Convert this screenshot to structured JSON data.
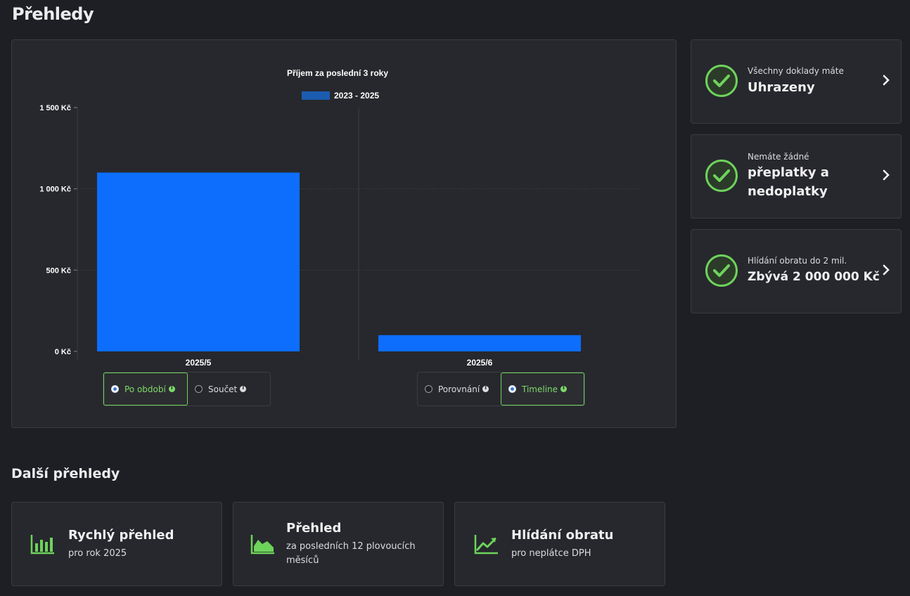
{
  "page": {
    "title": "Přehledy"
  },
  "chart_data": {
    "type": "bar",
    "title": "Příjem za poslední 3 roky",
    "categories": [
      "2025/5",
      "2025/6"
    ],
    "series": [
      {
        "name": "2023 - 2025",
        "values": [
          1100,
          100
        ],
        "color": "#0d6efd"
      }
    ],
    "yticks": [
      "0 Kč",
      "500 Kč",
      "1 000 Kč",
      "1 500 Kč"
    ],
    "ylim": [
      0,
      1500
    ],
    "legend_swatch_color": "#1c5cb0",
    "grid": true,
    "legend_position": "top-center"
  },
  "view_toggle": {
    "options": [
      {
        "label": "Po období",
        "active": true
      },
      {
        "label": "Součet",
        "active": false
      }
    ]
  },
  "mode_toggle": {
    "options": [
      {
        "label": "Porovnání",
        "active": false
      },
      {
        "label": "Timeline",
        "active": true
      }
    ]
  },
  "status_cards": [
    {
      "sub": "Všechny doklady máte",
      "main": "Uhrazeny"
    },
    {
      "sub": "Nemáte žádné",
      "main": "přeplatky a nedoplatky"
    },
    {
      "sub": "Hlídání obratu do 2 mil.",
      "main": "Zbývá 2 000 000 Kč"
    }
  ],
  "more": {
    "title": "Další přehledy",
    "tiles": [
      {
        "title": "Rychlý přehled",
        "sub": "pro rok 2025",
        "icon": "bar-chart-icon"
      },
      {
        "title": "Přehled",
        "sub": "za posledních 12 plovoucích měsíců",
        "icon": "area-chart-icon"
      },
      {
        "title": "Hlídání obratu",
        "sub": "pro neplátce DPH",
        "icon": "trend-up-icon"
      }
    ]
  },
  "colors": {
    "accent": "#6ed35b",
    "bar": "#0d6efd",
    "background": "#1e1f24",
    "card": "#27282d"
  }
}
